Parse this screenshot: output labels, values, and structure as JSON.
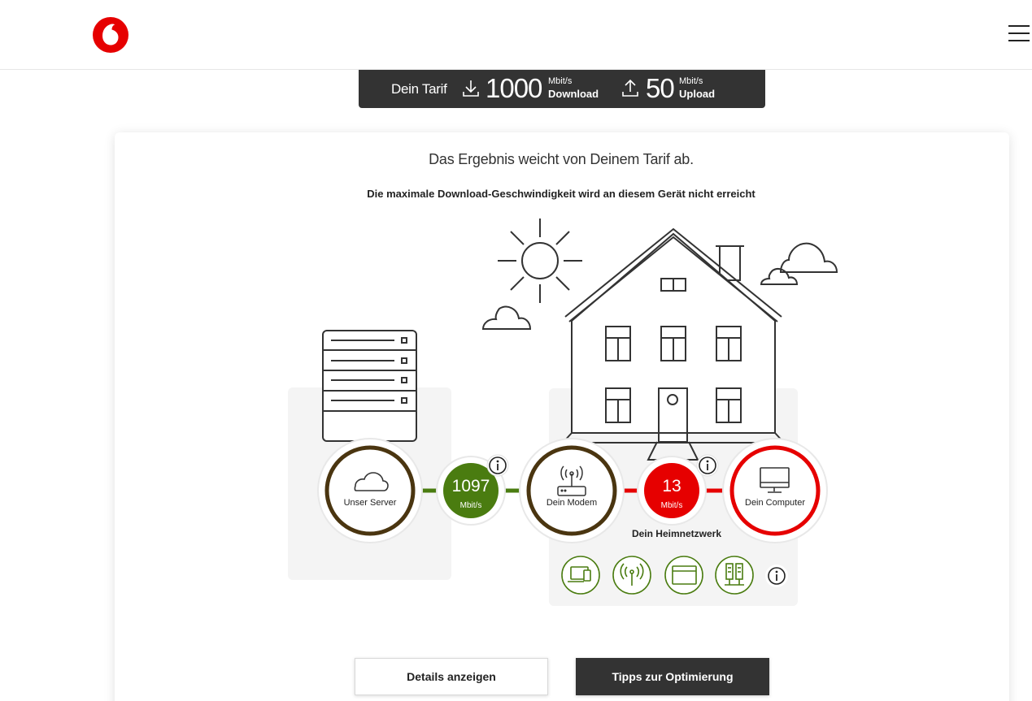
{
  "header": {
    "logo_icon": "vodafone-logo",
    "menu_icon": "hamburger-menu-icon"
  },
  "tariff": {
    "label": "Dein Tarif",
    "download_value": "1000",
    "download_unit": "Mbit/s",
    "download_label": "Download",
    "upload_value": "50",
    "upload_unit": "Mbit/s",
    "upload_label": "Upload"
  },
  "result": {
    "headline": "Das Ergebnis weicht von Deinem Tarif ab.",
    "subline": "Die maximale Download-Geschwindigkeit wird an diesem Gerät nicht erreicht"
  },
  "nodes": {
    "server_label": "Unser Server",
    "modem_label": "Dein Modem",
    "computer_label": "Dein Computer",
    "speed1_value": "1097",
    "speed1_unit": "Mbit/s",
    "speed2_value": "13",
    "speed2_unit": "Mbit/s",
    "heimnetz_label": "Dein Heimnetzwerk"
  },
  "buttons": {
    "details": "Details anzeigen",
    "tips": "Tipps zur Optimierung"
  },
  "colors": {
    "brand_red": "#e60000",
    "ok_green": "#4a7c10",
    "node_brown": "#4a3510",
    "dark": "#333333"
  }
}
